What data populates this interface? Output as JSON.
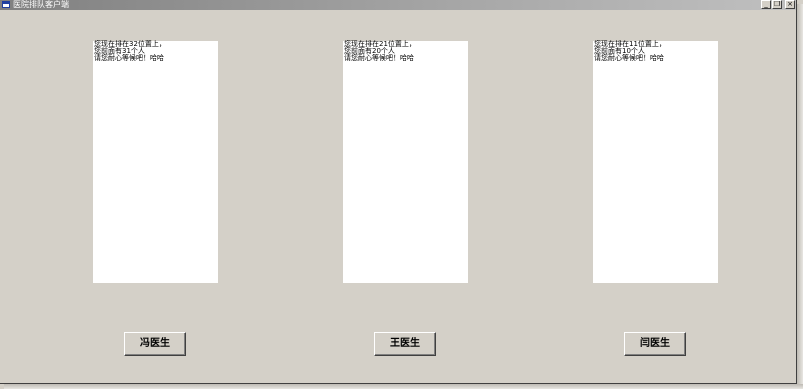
{
  "window": {
    "title": "医院排队客户端",
    "controls": {
      "minimize": "_",
      "restore": "❐",
      "close": "×"
    }
  },
  "panels": [
    {
      "lines": [
        "您现在排在32位置上，",
        "您前面有31个人",
        "请您耐心等候吧！哈哈"
      ]
    },
    {
      "lines": [
        "您现在排在21位置上，",
        "您前面有20个人",
        "请您耐心等候吧！哈哈"
      ]
    },
    {
      "lines": [
        "您现在排在11位置上，",
        "您前面有10个人",
        "请您耐心等候吧！哈哈"
      ]
    }
  ],
  "buttons": [
    {
      "label": "冯医生"
    },
    {
      "label": "王医生"
    },
    {
      "label": "闫医生"
    }
  ]
}
